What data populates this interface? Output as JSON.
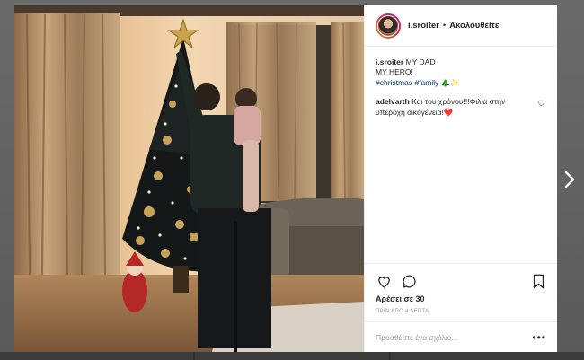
{
  "post": {
    "username": "i.sroiter",
    "separator": "•",
    "follow_label": "Ακολουθείτε",
    "caption_line1": "MY DAD",
    "caption_line2": "MY HERO!",
    "hashtags": [
      "#christmas",
      "#family"
    ],
    "caption_emoji": "🎄✨",
    "likes": "Αρέσει σε 30",
    "timestamp": "ΠΡΙΝ ΑΠΟ 4 ΛΕΠΤΑ",
    "comment_placeholder": "Προσθέστε ένα σχόλιο...",
    "more_label": "•••"
  },
  "comments": [
    {
      "username": "adelvarth",
      "text": "Και του χρόνου!!!Φιλια στην υπέροχη οικογένεια!",
      "emoji": "❤️"
    }
  ],
  "icons": {
    "like": "heart-icon",
    "comment": "comment-bubble-icon",
    "save": "bookmark-icon",
    "next": "chevron-right-icon"
  },
  "colors": {
    "hashtag": "#003569",
    "text": "#262626",
    "muted": "#999999"
  }
}
